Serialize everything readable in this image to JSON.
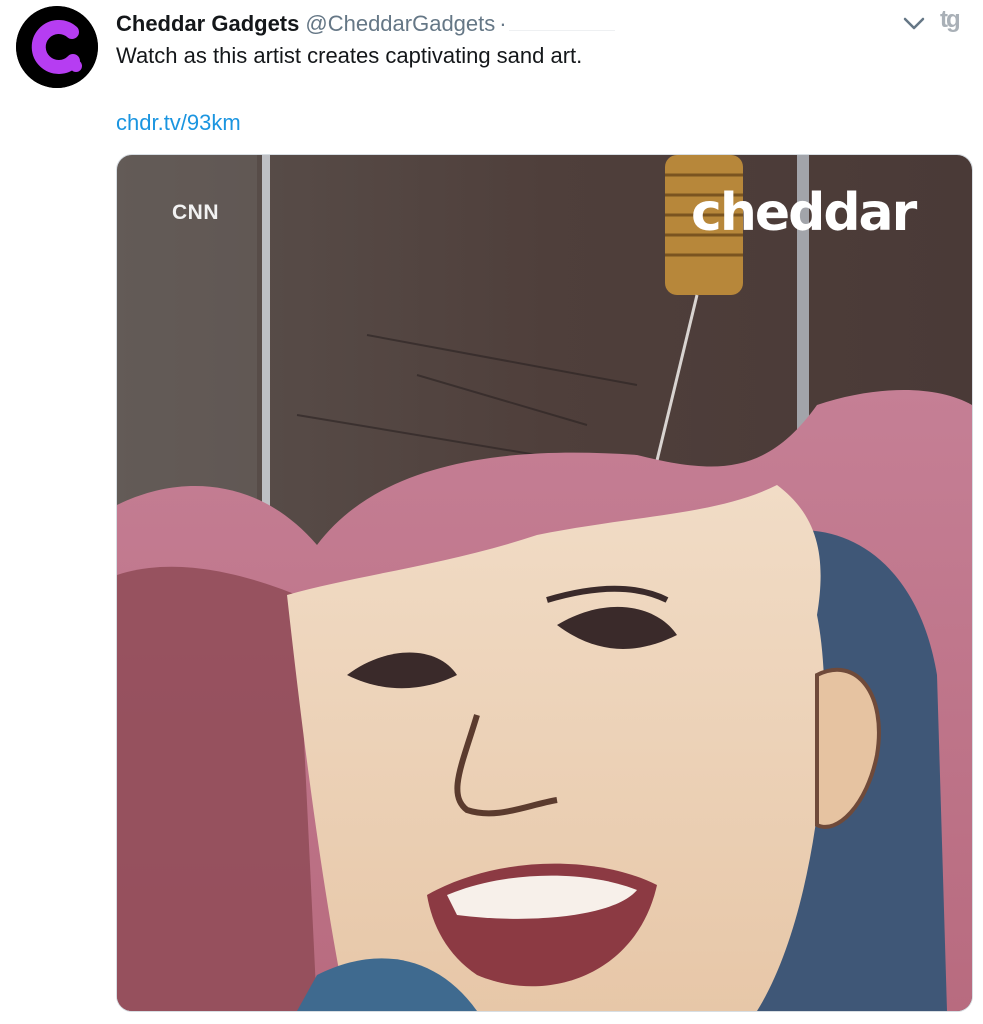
{
  "tweet": {
    "display_name": "Cheddar Gadgets",
    "handle": "@CheddarGadgets",
    "separator": "·",
    "text": "Watch as this artist creates captivating sand art.",
    "link": "chdr.tv/93km"
  },
  "media": {
    "watermark_left": "CNN",
    "watermark_right": "cheddar"
  },
  "icons": {
    "avatar": "cheddar-c-logo",
    "menu": "chevron-down-icon",
    "brand": "tg-logo-icon"
  },
  "top_right_glyph": "tg",
  "colors": {
    "link": "#1b95e0",
    "avatar_accent": "#b63df2",
    "muted": "#657786"
  }
}
